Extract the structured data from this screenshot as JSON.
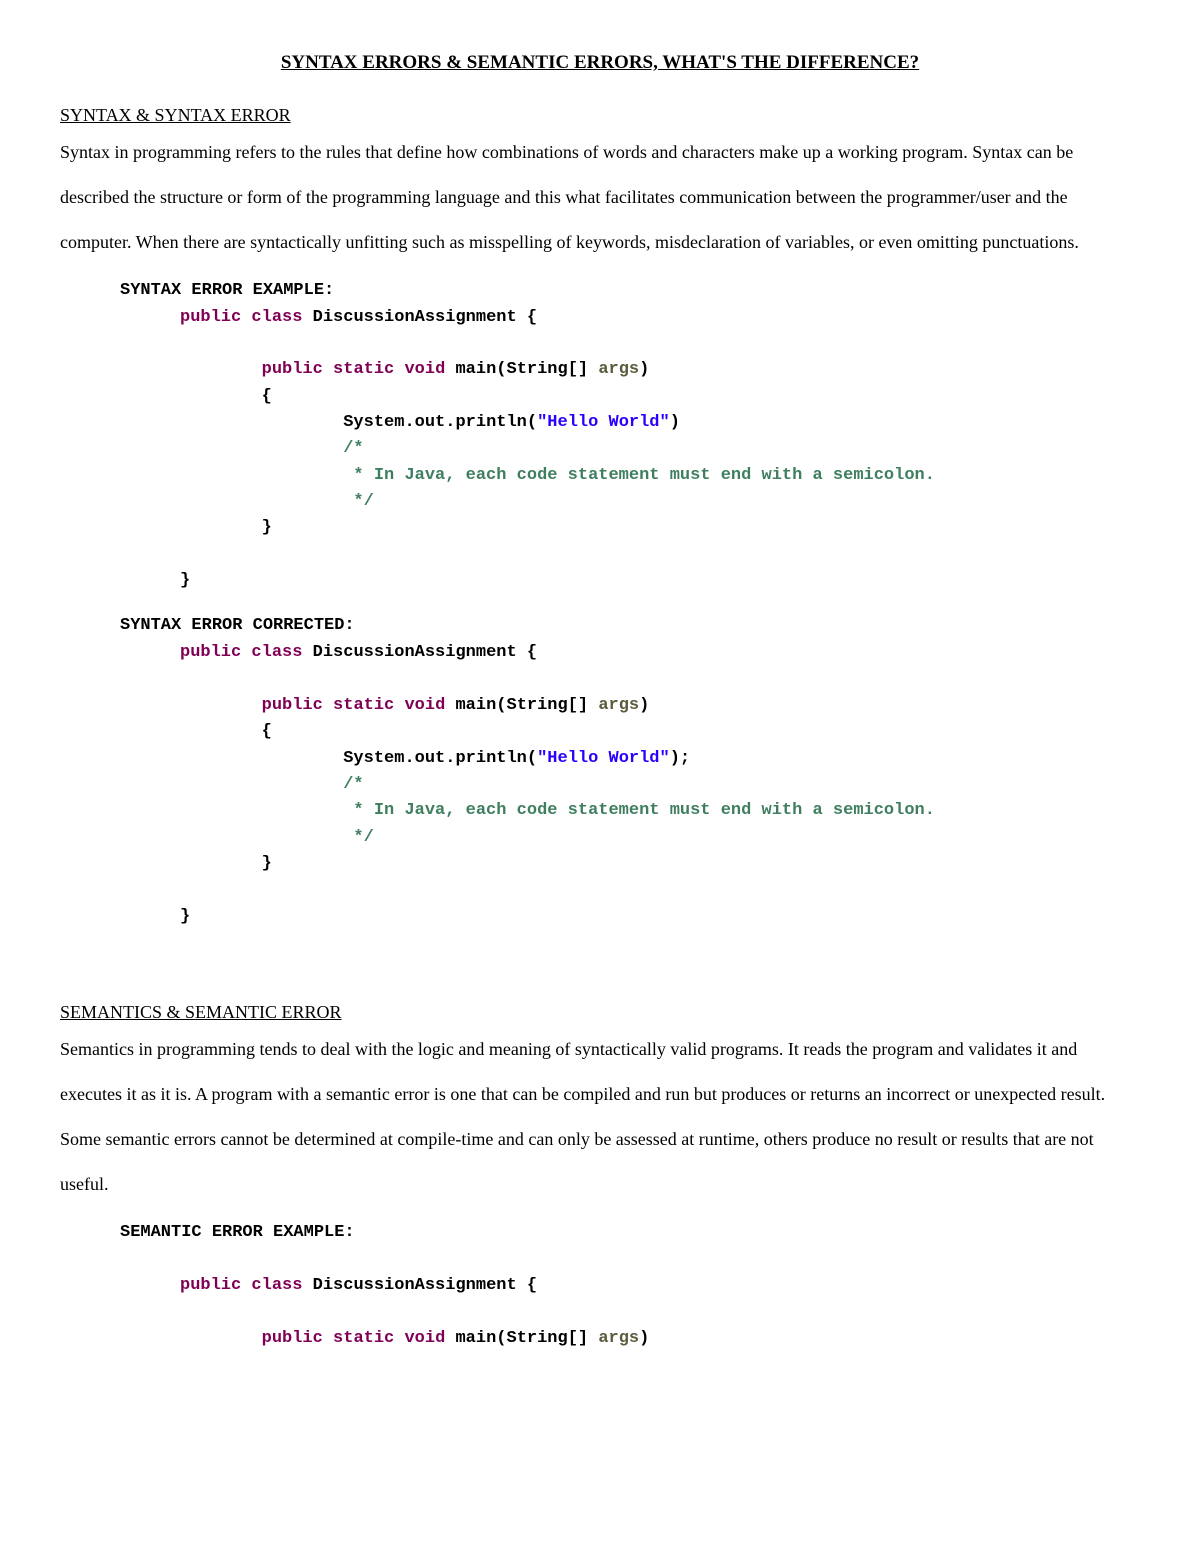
{
  "title": "SYNTAX ERRORS & SEMANTIC ERRORS, WHAT'S THE DIFFERENCE?",
  "syntax": {
    "heading": "SYNTAX & SYNTAX ERROR",
    "body": "Syntax in programming refers to the rules that define how combinations of words and characters make up a working program. Syntax can be described the structure or form of the programming language and this what facilitates communication between the programmer/user and the computer. When there are syntactically unfitting such as misspelling of keywords, misdeclaration of variables, or even omitting punctuations.",
    "example_heading": "SYNTAX ERROR EXAMPLE:",
    "corrected_heading": "SYNTAX ERROR CORRECTED:",
    "code_tokens": {
      "public": "public",
      "class": "class",
      "classname": "DiscussionAssignment",
      "static": "static",
      "void": "void",
      "main": "main",
      "string": "String",
      "args": "args",
      "system": "System",
      "out": "out",
      "println": "println",
      "hello": "\"Hello World\"",
      "comment_open": "/*",
      "comment_line": " * In Java, each code statement must end with a semicolon.",
      "comment_close": " */"
    }
  },
  "semantics": {
    "heading": "SEMANTICS & SEMANTIC ERROR",
    "body": "Semantics in programming tends to deal with the logic and meaning of syntactically valid programs. It reads the program and validates it and executes it as it is. A program with a semantic error is one that can be compiled and run but produces or returns an incorrect or unexpected result. Some semantic errors cannot be determined at compile-time and can only be assessed at runtime, others produce no result or results that are not useful.",
    "example_heading": "SEMANTIC ERROR EXAMPLE:"
  }
}
